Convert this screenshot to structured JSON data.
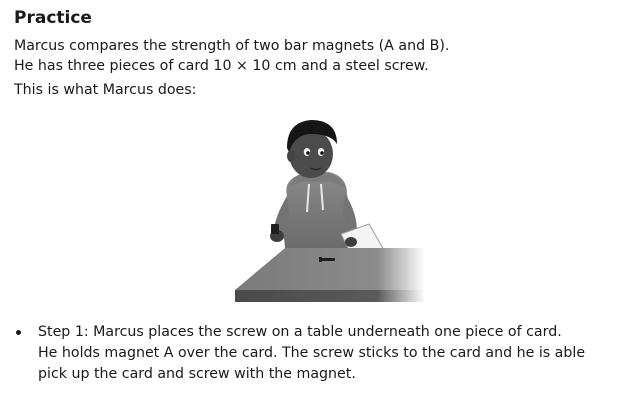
{
  "heading": "Practice",
  "intro": {
    "line1": "Marcus compares the strength of two bar magnets (A and B).",
    "line2": "He has three pieces of card 10 × 10 cm and a steel screw."
  },
  "lead": "This is what Marcus does:",
  "steps": [
    {
      "line1": "Step 1: Marcus places the screw on a table underneath one piece of card.",
      "line2": "He holds magnet A over the card. The screw sticks to the card and he is able",
      "line3": "pick up the card and screw with the magnet."
    }
  ]
}
